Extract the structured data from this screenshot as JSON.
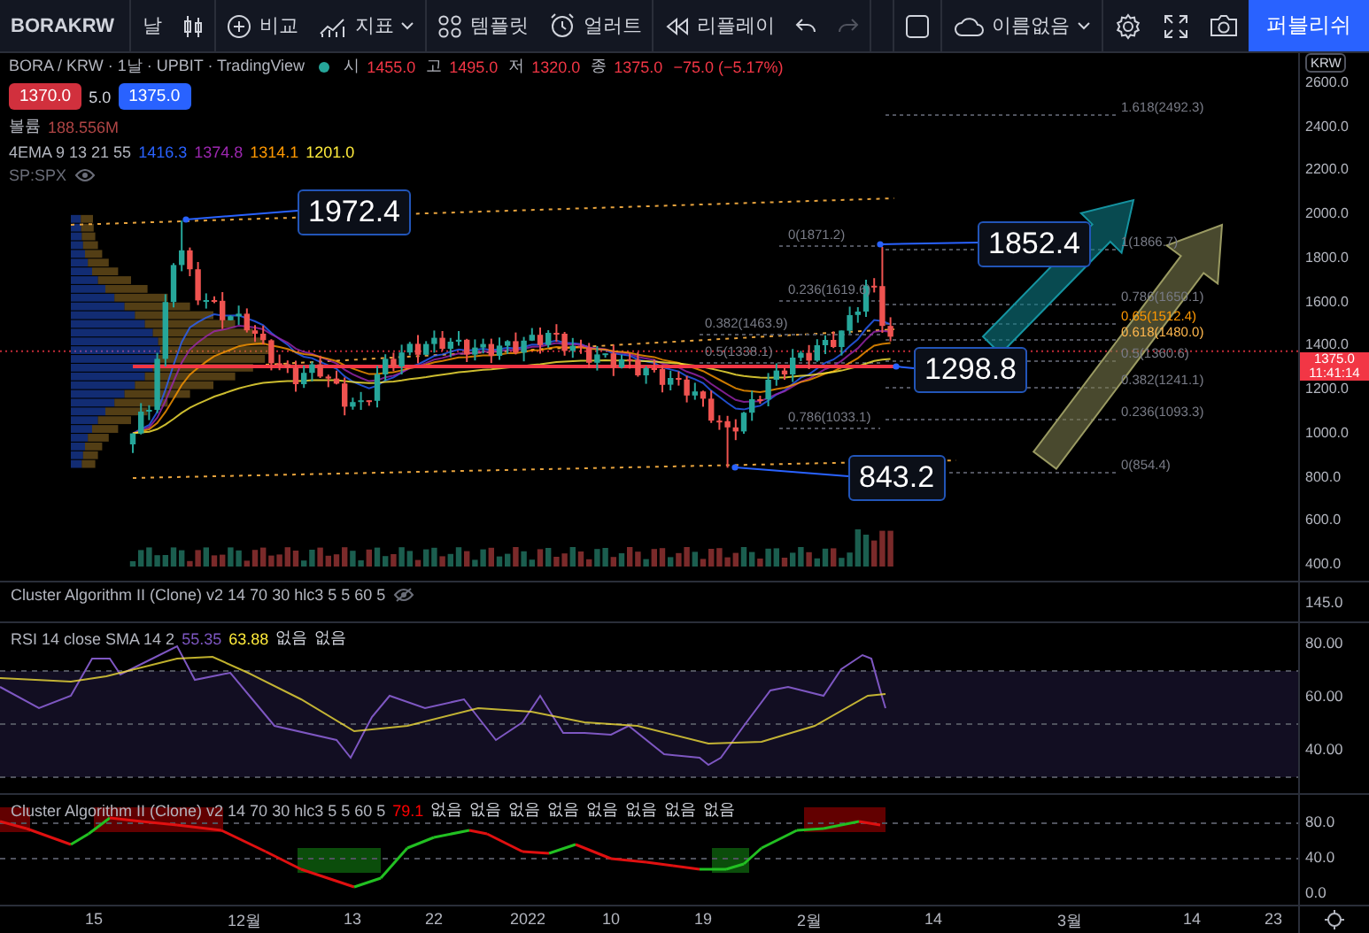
{
  "toolbar": {
    "symbol": "BORAKRW",
    "interval": "날",
    "buttons": [
      {
        "kind": "compare",
        "label": "비교"
      },
      {
        "kind": "indicators",
        "label": "지표"
      },
      {
        "kind": "templates",
        "label": "템플릿"
      },
      {
        "kind": "alert",
        "label": "얼러트"
      },
      {
        "kind": "replay",
        "label": "리플레이"
      }
    ],
    "layout_name": "이름없음",
    "publish": "퍼블리쉬"
  },
  "legend": {
    "title": "BORA / KRW · 1날 · UPBIT · TradingView",
    "ohlc": [
      {
        "label": "시",
        "value": "1455.0"
      },
      {
        "label": "고",
        "value": "1495.0"
      },
      {
        "label": "저",
        "value": "1320.0"
      },
      {
        "label": "종",
        "value": "1375.0"
      }
    ],
    "change": "−75.0 (−5.17%)",
    "sell_price": "1370.0",
    "spread": "5.0",
    "buy_price": "1375.0",
    "volume": {
      "label": "볼륨",
      "value": "188.556M"
    },
    "ema": {
      "label": "4EMA 9 13 21 55",
      "values": [
        {
          "value": "1416.3",
          "color": "#2962ff"
        },
        {
          "value": "1374.8",
          "color": "#9c27b0"
        },
        {
          "value": "1314.1",
          "color": "#ff9800"
        },
        {
          "value": "1201.0",
          "color": "#ffeb3b"
        }
      ]
    },
    "hidden_indicator": "SP:SPX"
  },
  "price_axis": {
    "currency": "KRW",
    "ticks": [
      "2600.0",
      "2400.0",
      "2200.0",
      "2000.0",
      "1800.0",
      "1600.0",
      "1400.0",
      "1200.0",
      "1000.0",
      "800.0",
      "600.0",
      "400.0"
    ],
    "last_price": "1375.0",
    "countdown": "11:41:14"
  },
  "callouts": [
    "1972.4",
    "1852.4",
    "1298.8",
    "843.2"
  ],
  "fib_left": [
    "0(1871.2)",
    "0.236(1619.6)",
    "0.382(1463.9)",
    "0.5(1338.1)",
    "0.786(1033.1)"
  ],
  "fib_right": [
    "1.618(2492.3)",
    "1(1866.7)",
    "0.786(1650.1)",
    "0.65(1512.4)",
    "0.618(1480.0)",
    "0.5(1360.6)",
    "0.382(1241.1)",
    "0.236(1093.3)",
    "0(854.4)"
  ],
  "panes": [
    {
      "kind": "hidden",
      "legend": "Cluster Algorithm II (Clone) v2 14 70 30 hlc3 5 5 60 5",
      "ticks": [
        "145.0"
      ]
    },
    {
      "kind": "rsi",
      "legend": "RSI 14 close SMA 14 2",
      "values": [
        {
          "value": "55.35",
          "color": "#7e57c2"
        },
        {
          "value": "63.88",
          "color": "#ffeb3b"
        },
        {
          "value": "없음",
          "color": "#d1d4dc"
        },
        {
          "value": "없음",
          "color": "#d1d4dc"
        }
      ],
      "ticks": [
        "80.00",
        "60.00",
        "40.00"
      ]
    },
    {
      "kind": "cluster",
      "legend": "Cluster Algorithm II (Clone) v2 14 70 30 hlc3 5 5 60 5",
      "values": [
        {
          "value": "79.1",
          "color": "#ff0000"
        },
        {
          "value": "없음",
          "color": "#d1d4dc"
        },
        {
          "value": "없음",
          "color": "#d1d4dc"
        },
        {
          "value": "없음",
          "color": "#d1d4dc"
        },
        {
          "value": "없음",
          "color": "#d1d4dc"
        },
        {
          "value": "없음",
          "color": "#d1d4dc"
        },
        {
          "value": "없음",
          "color": "#d1d4dc"
        },
        {
          "value": "없음",
          "color": "#d1d4dc"
        },
        {
          "value": "없음",
          "color": "#d1d4dc"
        }
      ],
      "ticks": [
        "80.0",
        "40.0",
        "0.0"
      ]
    }
  ],
  "time_axis": [
    "15",
    "12월",
    "13",
    "22",
    "2022",
    "10",
    "19",
    "2월",
    "14",
    "3월",
    "14",
    "23"
  ]
}
